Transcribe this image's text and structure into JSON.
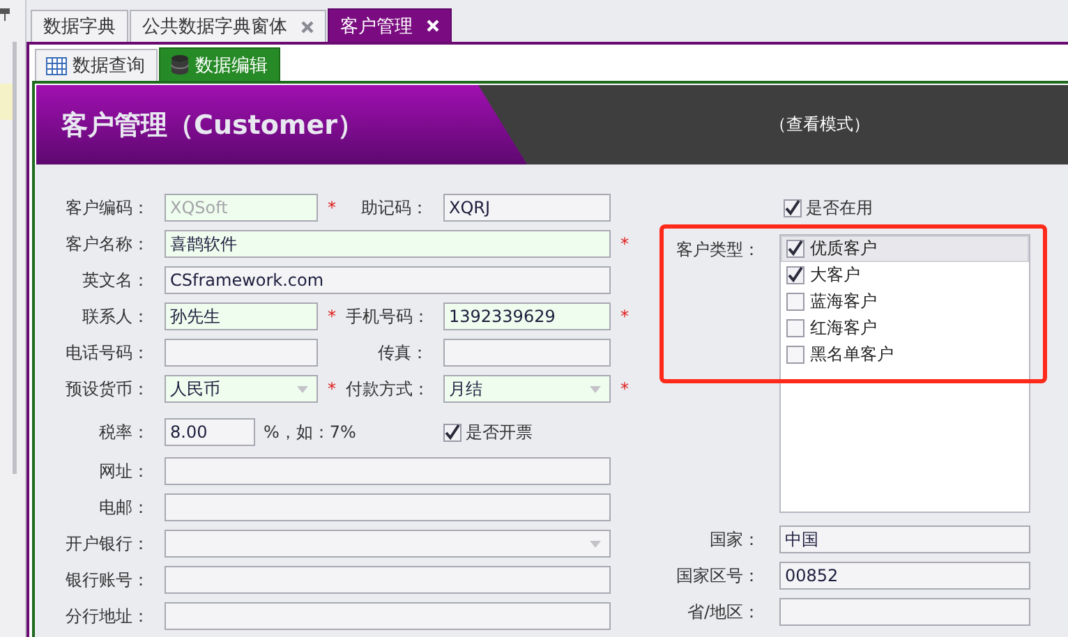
{
  "doc_tabs": [
    {
      "label": "数据字典",
      "selected": false,
      "closable": false
    },
    {
      "label": "公共数据字典窗体",
      "selected": false,
      "closable": true
    },
    {
      "label": "客户管理",
      "selected": true,
      "closable": true
    }
  ],
  "view_tabs": [
    {
      "label": "数据查询",
      "selected": false
    },
    {
      "label": "数据编辑",
      "selected": true
    }
  ],
  "header": {
    "title": "客户管理（Customer）",
    "mode": "（查看模式）"
  },
  "form_rows": [
    [
      {
        "kind": "text",
        "label": "客户编码：",
        "value": "XQSoft",
        "required_mark": "*",
        "disabled": true
      },
      {
        "kind": "text",
        "label": "助记码：",
        "value": "XQRJ",
        "disabled": false
      }
    ],
    [
      {
        "kind": "text",
        "label": "客户名称：",
        "value": "喜鹊软件",
        "required_mark": "*",
        "disabled": false
      }
    ],
    [
      {
        "kind": "text",
        "label": "英文名：",
        "value": "CSframework.com",
        "disabled": false
      }
    ],
    [
      {
        "kind": "text",
        "label": "联系人：",
        "value": "孙先生",
        "required_mark": "*",
        "disabled": false
      },
      {
        "kind": "text",
        "label": "手机号码：",
        "value": "1392339629",
        "required_mark": "*",
        "disabled": false
      }
    ],
    [
      {
        "kind": "text",
        "label": "电话号码："
      },
      {
        "kind": "text",
        "label": "传真："
      }
    ],
    [
      {
        "kind": "dropdown",
        "label": "预设货币：",
        "value": "人民币",
        "required_mark": "*",
        "disabled": false
      },
      {
        "kind": "dropdown",
        "label": "付款方式：",
        "value": "月结",
        "required_mark": "*",
        "disabled": false
      }
    ],
    [
      {
        "kind": "short",
        "label": "税率：",
        "value": "8.00",
        "suffix": "%，如：7%",
        "disabled": false
      },
      {
        "kind": "checkbox",
        "label": "是否开票",
        "checked": true
      }
    ],
    [
      {
        "kind": "text",
        "label": "网址："
      }
    ],
    [
      {
        "kind": "text",
        "label": "电邮："
      }
    ],
    [
      {
        "kind": "dropdown",
        "label": "开户银行："
      }
    ],
    [
      {
        "kind": "text",
        "label": "银行账号："
      }
    ],
    [
      {
        "kind": "text",
        "label": "分行地址："
      }
    ]
  ],
  "in_use": {
    "label": "是否在用",
    "checked": true
  },
  "customer_type": {
    "label": "客户类型：",
    "options": [
      {
        "label": "优质客户",
        "checked": true,
        "selected": true
      },
      {
        "label": "大客户",
        "checked": true,
        "selected": false
      },
      {
        "label": "蓝海客户",
        "checked": false,
        "selected": false
      },
      {
        "label": "红海客户",
        "checked": false,
        "selected": false
      },
      {
        "label": "黑名单客户",
        "checked": false,
        "selected": false
      }
    ]
  },
  "right_fields": [
    {
      "label": "国家：",
      "value": "中国"
    },
    {
      "label": "国家区号：",
      "value": "00852"
    },
    {
      "label": "省/地区："
    }
  ]
}
